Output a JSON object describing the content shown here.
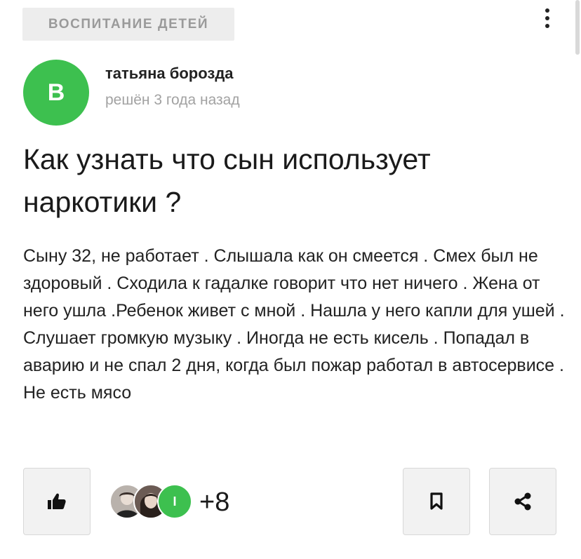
{
  "header": {
    "category": "ВОСПИТАНИЕ ДЕТЕЙ",
    "more_icon": "more-vertical-icon"
  },
  "author": {
    "avatar_letter": "В",
    "avatar_color": "#3dc04f",
    "name": "татьяна борозда",
    "status": "решён 3 года назад"
  },
  "question": {
    "title": "Как узнать что сын использует наркотики ?",
    "body": "Сыну 32, не работает . Слышала как он смеется . Смех был не здоровый . Сходила к гадалке говорит что нет ничего . Жена от него ушла .Ребенок живет с мной . Нашла у него капли для ушей . Слушает громкую музыку . Иногда не есть кисель . Попадал в аварию и не спал 2 дня, когда был пожар работал в автосервисе . Не есть мясо"
  },
  "actions": {
    "like_icon": "thumbs-up-icon",
    "bookmark_icon": "bookmark-icon",
    "share_icon": "share-icon",
    "supporter_third_letter": "I",
    "supporters_more": "+8"
  }
}
